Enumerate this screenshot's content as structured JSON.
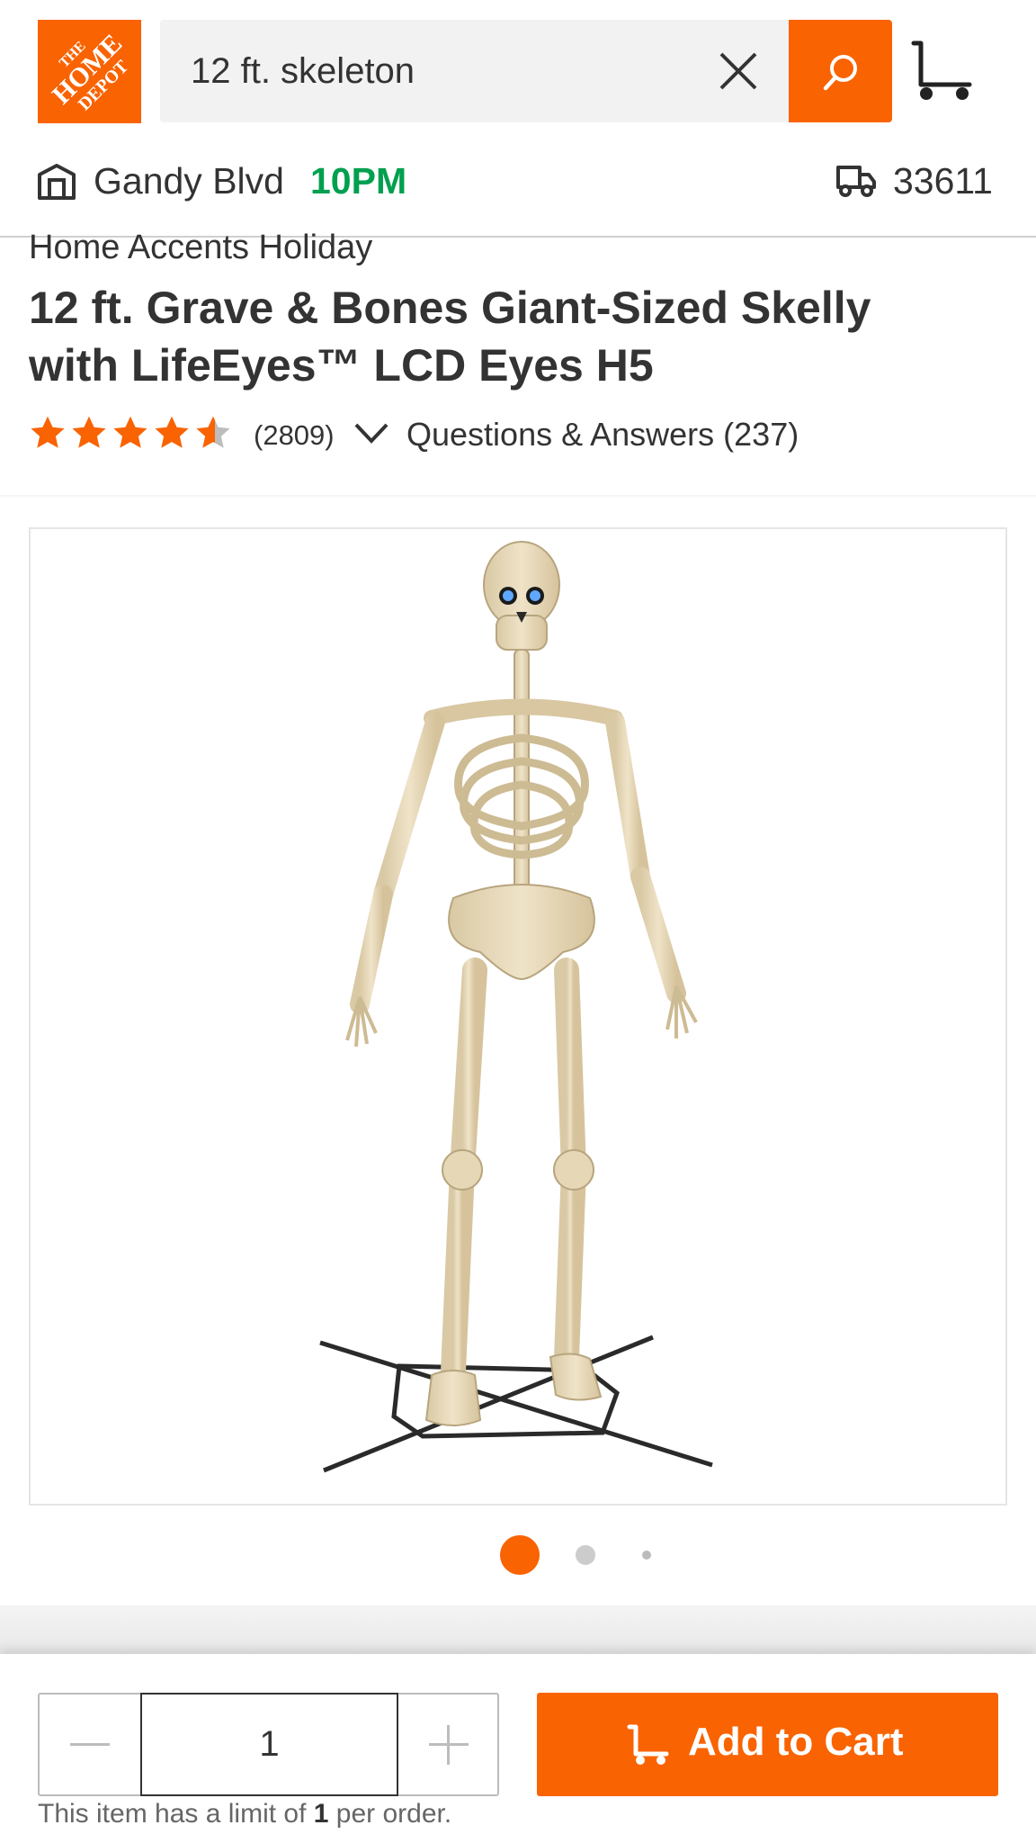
{
  "header": {
    "logo_text": "THE HOME DEPOT",
    "search_value": "12 ft. skeleton",
    "store_name": "Gandy Blvd",
    "store_hours": "10PM",
    "zip": "33611"
  },
  "product": {
    "brand": "Home Accents Holiday",
    "title": "12 ft. Grave & Bones Giant-Sized Skelly with LifeEyes™ LCD Eyes H5",
    "rating": 4.6,
    "review_count": "(2809)",
    "qa_label": "Questions & Answers (237)"
  },
  "gallery": {
    "image_alt": "12 ft. skeleton product photo",
    "current_index": 1,
    "dots": 3
  },
  "cart_bar": {
    "quantity": "1",
    "add_to_cart_label": "Add to Cart",
    "limit_prefix": "This item has a limit of",
    "limit_value": "1",
    "limit_suffix": "per order."
  },
  "colors": {
    "brand_orange": "#f96302",
    "hours_green": "#00a04f",
    "text": "#333333"
  },
  "icons": [
    "home-depot-logo",
    "close-icon",
    "search-icon",
    "cart-icon",
    "store-icon",
    "truck-icon",
    "star-icon",
    "chevron-down-icon",
    "chevron-right-icon",
    "minus-icon",
    "plus-icon",
    "cart-icon"
  ]
}
